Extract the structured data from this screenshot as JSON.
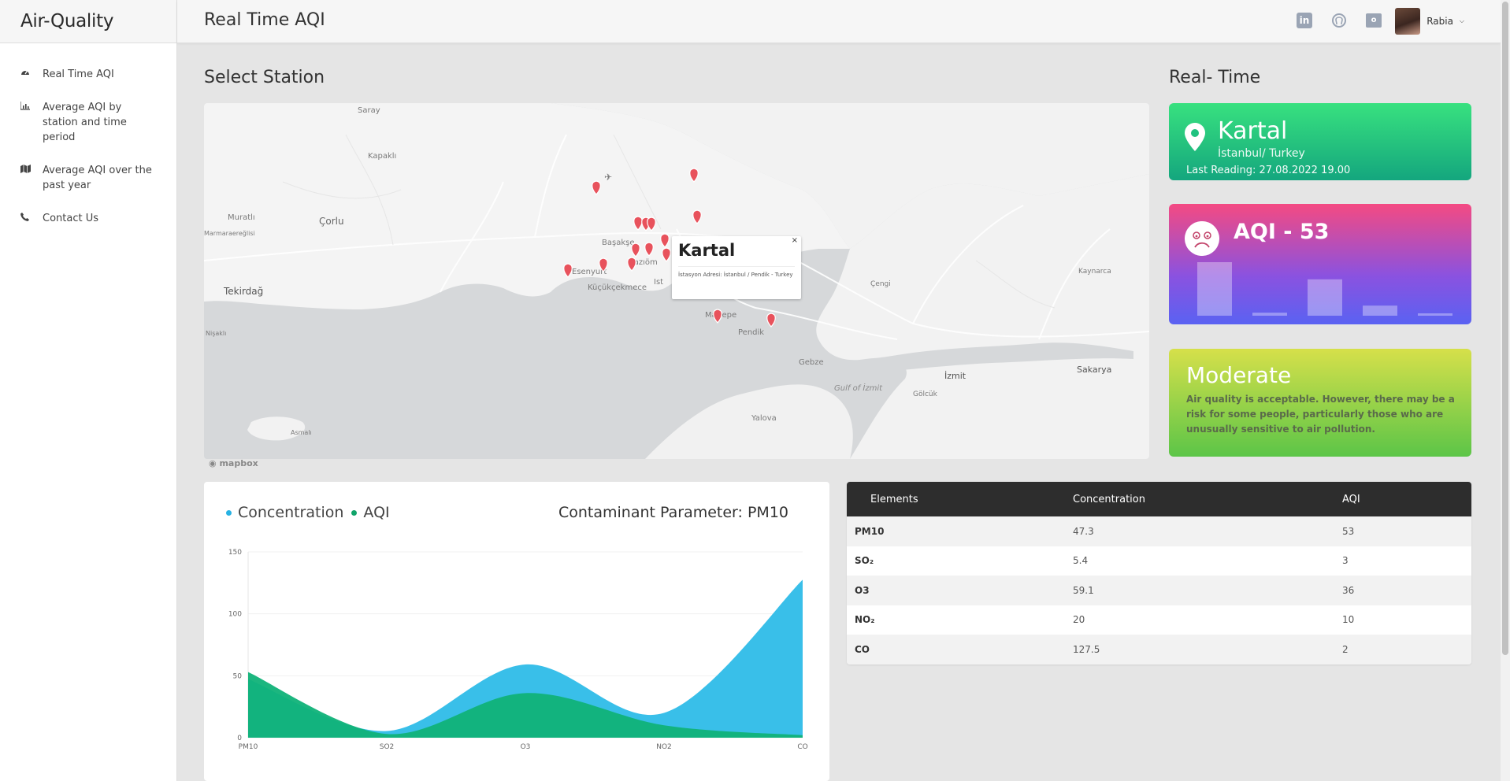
{
  "app": {
    "brand": "Air-Quality",
    "page_title": "Real Time AQI"
  },
  "sidebar": {
    "items": [
      {
        "label": "Real Time AQI",
        "icon": "dashboard-icon"
      },
      {
        "label": "Average AQI by station and time period",
        "icon": "bar-chart-icon"
      },
      {
        "label": "Average AQI over the past year",
        "icon": "map-icon"
      },
      {
        "label": "Contact Us",
        "icon": "phone-icon"
      }
    ]
  },
  "topbar": {
    "user_name": "Rabia",
    "icons": [
      "linkedin-icon",
      "github-icon",
      "outlook-icon"
    ]
  },
  "map_section": {
    "title": "Select Station",
    "attribution": "mapbox",
    "labels": [
      "Saray",
      "Kapaklı",
      "Muratlı",
      "Çorlu",
      "Tekirdağ",
      "Esenyurt",
      "Başakşe",
      "Dazıöm",
      "Küçükçekmece",
      "Ist",
      "Maltepe",
      "Pendik",
      "Gebze",
      "Çengi",
      "Kaynarca",
      "Sakarya",
      "İzmit",
      "Gulf of İzmit",
      "Gölcük",
      "Yalova",
      "Asmalı",
      "Marmaraereğlisi",
      "Nişaklı"
    ],
    "popup": {
      "title": "Kartal",
      "address": "İstasyon Adresi: İstanbul / Pendik - Turkey",
      "close": "×"
    }
  },
  "realtime": {
    "title": "Real- Time",
    "station": "Kartal",
    "location": "İstanbul/ Turkey",
    "last_reading": "Last Reading: 27.08.2022 19.00",
    "aqi_label": "AQI - 53",
    "aqi_bar_values": [
      53,
      3,
      36,
      10,
      2
    ],
    "category": "Moderate",
    "description": "Air quality is acceptable. However, there may be a risk for some people, particularly those who are unusually sensitive to air pollution.",
    "colors": {
      "location": "#1fc27f",
      "aqi": "#f44a82",
      "category": "#8ed146"
    }
  },
  "chart": {
    "legend": {
      "series1": "Concentration",
      "series2": "AQI"
    },
    "param_label": "Contaminant Parameter: PM10"
  },
  "chart_data": {
    "type": "area",
    "categories": [
      "PM10",
      "SO2",
      "O3",
      "NO2",
      "CO"
    ],
    "series": [
      {
        "name": "Concentration",
        "values": [
          47.3,
          5.4,
          59.1,
          20,
          127.5
        ],
        "color": "#33bde8"
      },
      {
        "name": "AQI",
        "values": [
          53,
          3,
          36,
          10,
          2
        ],
        "color": "#10b278"
      }
    ],
    "yticks": [
      0,
      50,
      100,
      150
    ],
    "ylim": [
      0,
      150
    ],
    "smooth": true
  },
  "table": {
    "headers": [
      "Elements",
      "Concentration",
      "AQI"
    ],
    "rows": [
      [
        "PM10",
        "47.3",
        "53"
      ],
      [
        "SO₂",
        "5.4",
        "3"
      ],
      [
        "O3",
        "59.1",
        "36"
      ],
      [
        "NO₂",
        "20",
        "10"
      ],
      [
        "CO",
        "127.5",
        "2"
      ]
    ]
  }
}
